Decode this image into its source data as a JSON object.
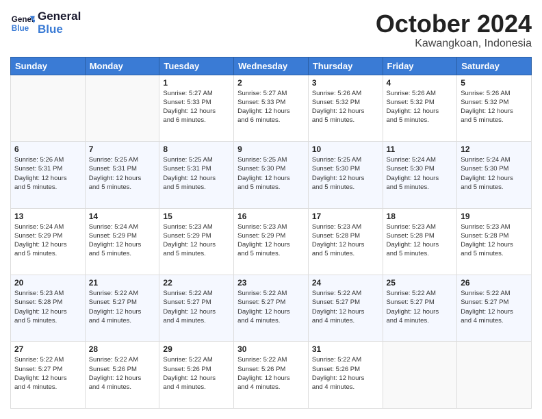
{
  "logo": {
    "line1": "General",
    "line2": "Blue"
  },
  "title": "October 2024",
  "location": "Kawangkoan, Indonesia",
  "days_header": [
    "Sunday",
    "Monday",
    "Tuesday",
    "Wednesday",
    "Thursday",
    "Friday",
    "Saturday"
  ],
  "weeks": [
    [
      {
        "num": "",
        "info": ""
      },
      {
        "num": "",
        "info": ""
      },
      {
        "num": "1",
        "info": "Sunrise: 5:27 AM\nSunset: 5:33 PM\nDaylight: 12 hours\nand 6 minutes."
      },
      {
        "num": "2",
        "info": "Sunrise: 5:27 AM\nSunset: 5:33 PM\nDaylight: 12 hours\nand 6 minutes."
      },
      {
        "num": "3",
        "info": "Sunrise: 5:26 AM\nSunset: 5:32 PM\nDaylight: 12 hours\nand 5 minutes."
      },
      {
        "num": "4",
        "info": "Sunrise: 5:26 AM\nSunset: 5:32 PM\nDaylight: 12 hours\nand 5 minutes."
      },
      {
        "num": "5",
        "info": "Sunrise: 5:26 AM\nSunset: 5:32 PM\nDaylight: 12 hours\nand 5 minutes."
      }
    ],
    [
      {
        "num": "6",
        "info": "Sunrise: 5:26 AM\nSunset: 5:31 PM\nDaylight: 12 hours\nand 5 minutes."
      },
      {
        "num": "7",
        "info": "Sunrise: 5:25 AM\nSunset: 5:31 PM\nDaylight: 12 hours\nand 5 minutes."
      },
      {
        "num": "8",
        "info": "Sunrise: 5:25 AM\nSunset: 5:31 PM\nDaylight: 12 hours\nand 5 minutes."
      },
      {
        "num": "9",
        "info": "Sunrise: 5:25 AM\nSunset: 5:30 PM\nDaylight: 12 hours\nand 5 minutes."
      },
      {
        "num": "10",
        "info": "Sunrise: 5:25 AM\nSunset: 5:30 PM\nDaylight: 12 hours\nand 5 minutes."
      },
      {
        "num": "11",
        "info": "Sunrise: 5:24 AM\nSunset: 5:30 PM\nDaylight: 12 hours\nand 5 minutes."
      },
      {
        "num": "12",
        "info": "Sunrise: 5:24 AM\nSunset: 5:30 PM\nDaylight: 12 hours\nand 5 minutes."
      }
    ],
    [
      {
        "num": "13",
        "info": "Sunrise: 5:24 AM\nSunset: 5:29 PM\nDaylight: 12 hours\nand 5 minutes."
      },
      {
        "num": "14",
        "info": "Sunrise: 5:24 AM\nSunset: 5:29 PM\nDaylight: 12 hours\nand 5 minutes."
      },
      {
        "num": "15",
        "info": "Sunrise: 5:23 AM\nSunset: 5:29 PM\nDaylight: 12 hours\nand 5 minutes."
      },
      {
        "num": "16",
        "info": "Sunrise: 5:23 AM\nSunset: 5:29 PM\nDaylight: 12 hours\nand 5 minutes."
      },
      {
        "num": "17",
        "info": "Sunrise: 5:23 AM\nSunset: 5:28 PM\nDaylight: 12 hours\nand 5 minutes."
      },
      {
        "num": "18",
        "info": "Sunrise: 5:23 AM\nSunset: 5:28 PM\nDaylight: 12 hours\nand 5 minutes."
      },
      {
        "num": "19",
        "info": "Sunrise: 5:23 AM\nSunset: 5:28 PM\nDaylight: 12 hours\nand 5 minutes."
      }
    ],
    [
      {
        "num": "20",
        "info": "Sunrise: 5:23 AM\nSunset: 5:28 PM\nDaylight: 12 hours\nand 5 minutes."
      },
      {
        "num": "21",
        "info": "Sunrise: 5:22 AM\nSunset: 5:27 PM\nDaylight: 12 hours\nand 4 minutes."
      },
      {
        "num": "22",
        "info": "Sunrise: 5:22 AM\nSunset: 5:27 PM\nDaylight: 12 hours\nand 4 minutes."
      },
      {
        "num": "23",
        "info": "Sunrise: 5:22 AM\nSunset: 5:27 PM\nDaylight: 12 hours\nand 4 minutes."
      },
      {
        "num": "24",
        "info": "Sunrise: 5:22 AM\nSunset: 5:27 PM\nDaylight: 12 hours\nand 4 minutes."
      },
      {
        "num": "25",
        "info": "Sunrise: 5:22 AM\nSunset: 5:27 PM\nDaylight: 12 hours\nand 4 minutes."
      },
      {
        "num": "26",
        "info": "Sunrise: 5:22 AM\nSunset: 5:27 PM\nDaylight: 12 hours\nand 4 minutes."
      }
    ],
    [
      {
        "num": "27",
        "info": "Sunrise: 5:22 AM\nSunset: 5:27 PM\nDaylight: 12 hours\nand 4 minutes."
      },
      {
        "num": "28",
        "info": "Sunrise: 5:22 AM\nSunset: 5:26 PM\nDaylight: 12 hours\nand 4 minutes."
      },
      {
        "num": "29",
        "info": "Sunrise: 5:22 AM\nSunset: 5:26 PM\nDaylight: 12 hours\nand 4 minutes."
      },
      {
        "num": "30",
        "info": "Sunrise: 5:22 AM\nSunset: 5:26 PM\nDaylight: 12 hours\nand 4 minutes."
      },
      {
        "num": "31",
        "info": "Sunrise: 5:22 AM\nSunset: 5:26 PM\nDaylight: 12 hours\nand 4 minutes."
      },
      {
        "num": "",
        "info": ""
      },
      {
        "num": "",
        "info": ""
      }
    ]
  ]
}
